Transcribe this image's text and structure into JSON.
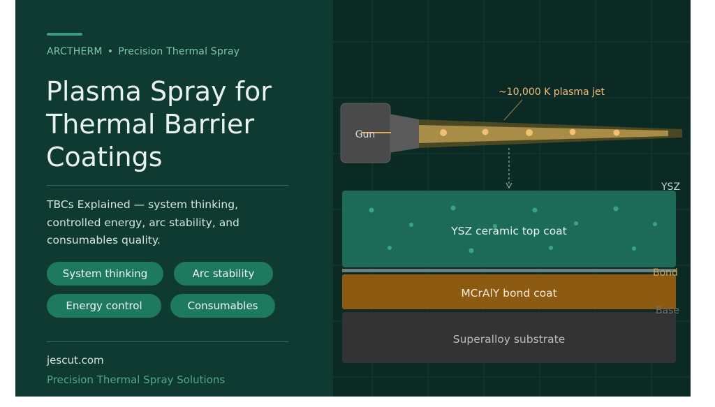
{
  "brand": {
    "name": "ARCTHERM",
    "separator": "•",
    "tagline": "Precision Thermal Spray"
  },
  "title": "Plasma Spray for Thermal Barrier Coatings",
  "subtitle": "TBCs Explained — system thinking, controlled energy, arc stability, and consumables quality.",
  "chips": [
    {
      "label": "System thinking"
    },
    {
      "label": "Arc stability"
    },
    {
      "label": "Energy control"
    },
    {
      "label": "Consumables"
    }
  ],
  "footer": {
    "site": "jescut.com",
    "tagline": "Precision Thermal Spray Solutions"
  },
  "diagram": {
    "gun_label": "Gun",
    "jet_label": "~10,000 K plasma jet",
    "layers": {
      "top_coat": {
        "label": "YSZ ceramic top coat",
        "side_label": "YSZ",
        "color": "#1c6b58"
      },
      "bond_coat": {
        "label": "MCrAlY bond coat",
        "side_label": "Bond",
        "color": "#8c5a10"
      },
      "substrate": {
        "label": "Superalloy substrate",
        "side_label": "Base",
        "color": "#333333"
      }
    },
    "colors": {
      "jet": "#b79a4e",
      "particles": "#f0c074",
      "jet_label": "#f2c07a",
      "top_coat_particles": "#3da483"
    }
  }
}
